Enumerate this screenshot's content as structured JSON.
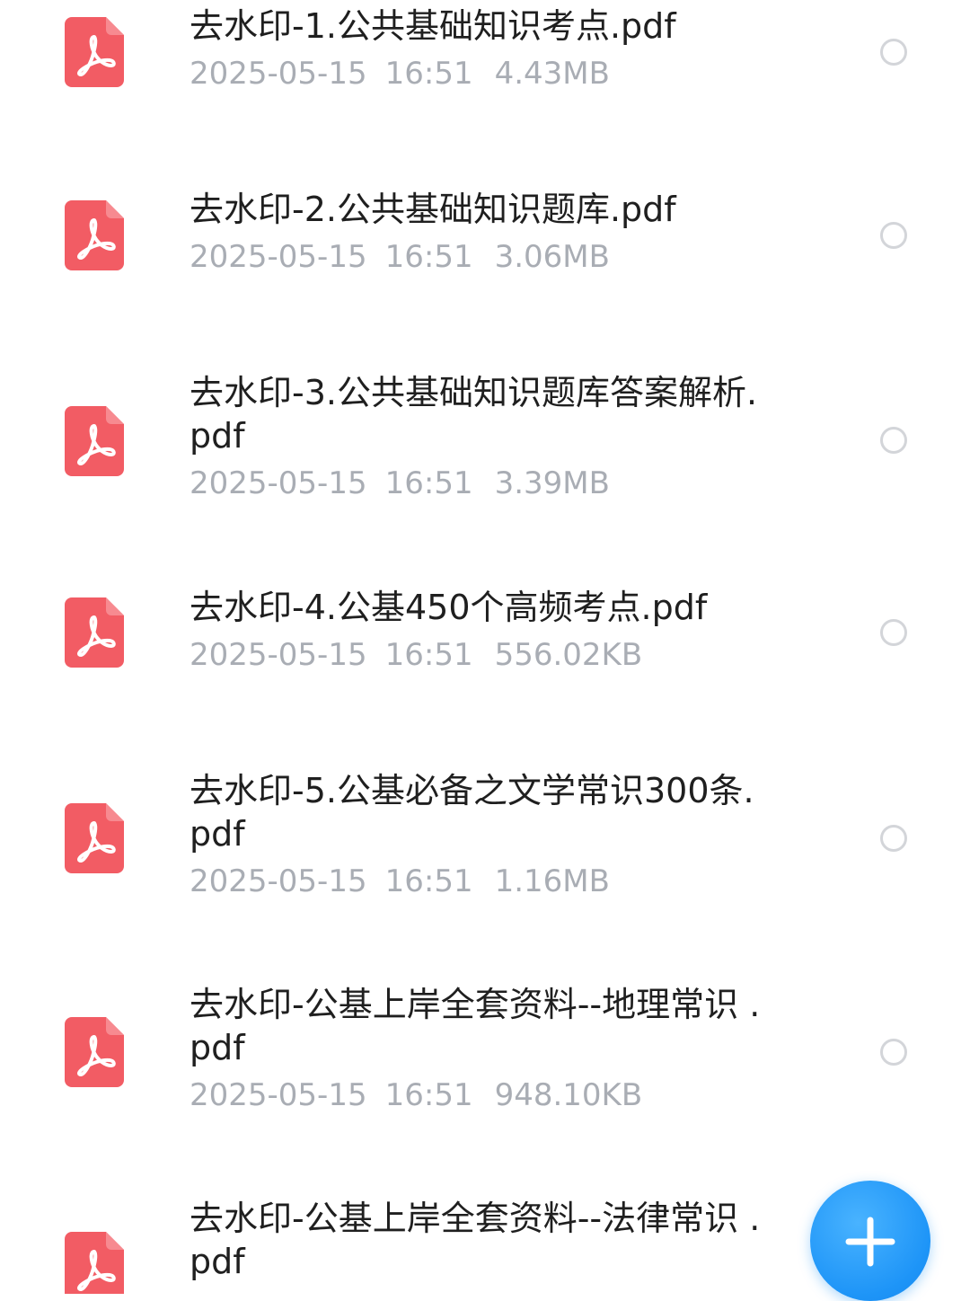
{
  "files": [
    {
      "name": "去水印-1.公共基础知识考点.pdf",
      "date": "2025-05-15",
      "time": "16:51",
      "size": "4.43MB",
      "icon": "pdf-icon"
    },
    {
      "name": "去水印-2.公共基础知识题库.pdf",
      "date": "2025-05-15",
      "time": "16:51",
      "size": "3.06MB",
      "icon": "pdf-icon"
    },
    {
      "name": "去水印-3.公共基础知识题库答案解析.pdf",
      "date": "2025-05-15",
      "time": "16:51",
      "size": "3.39MB",
      "icon": "pdf-icon"
    },
    {
      "name": "去水印-4.公基450个高频考点.pdf",
      "date": "2025-05-15",
      "time": "16:51",
      "size": "556.02KB",
      "icon": "pdf-icon"
    },
    {
      "name": "去水印-5.公基必备之文学常识300条.pdf",
      "date": "2025-05-15",
      "time": "16:51",
      "size": "1.16MB",
      "icon": "pdf-icon"
    },
    {
      "name": "去水印-公基上岸全套资料--地理常识 .pdf",
      "date": "2025-05-15",
      "time": "16:51",
      "size": "948.10KB",
      "icon": "pdf-icon"
    },
    {
      "name": "去水印-公基上岸全套资料--法律常识 .pdf",
      "date": "",
      "time": "",
      "size": "",
      "icon": "pdf-icon"
    }
  ],
  "fab": {
    "icon": "plus-icon"
  },
  "colors": {
    "pdf_icon": "#f25c64",
    "title_text": "#1f1f1f",
    "meta_text": "#a9adb4",
    "radio_border": "#d3d5d9",
    "fab": "#1d94f7"
  }
}
